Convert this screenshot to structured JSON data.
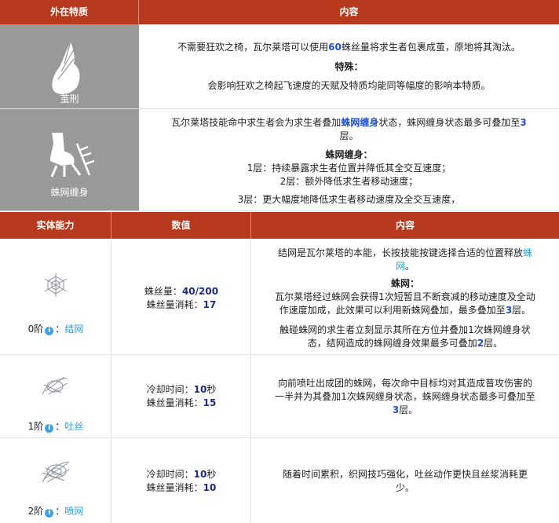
{
  "table1": {
    "headers": [
      "外在特质",
      "内容"
    ],
    "rows": [
      {
        "name": "茧刑",
        "line1_pre": "不需要狂欢之椅，瓦尔莱塔可以使用",
        "line1_num": "60",
        "line1_post": "蛛丝量将求生者包裹成茧，原地将其淘汰。",
        "special_title": "特殊：",
        "special_text": "会影响狂欢之椅起飞速度的天赋及特质均能同等幅度的影响本特质。"
      },
      {
        "name": "蛛网缠身",
        "l1_pre": "瓦尔莱塔技能命中求生者会为求生者叠加",
        "l1_link": "蛛网缠身",
        "l1_mid": "状态，蛛网缠身状态最多可叠加至",
        "l1_num": "3",
        "l2": "层。",
        "sub_title": "蛛网缠身：",
        "layer1": "1层：持续暴露求生者位置并降低其全交互速度；",
        "layer2": "2层：额外降低求生者移动速度；",
        "layer3": "3层：更大幅度地降低求生者移动速度及全交互速度，"
      }
    ]
  },
  "table2": {
    "headers": [
      "实体能力",
      "数值",
      "内容"
    ],
    "rows": [
      {
        "tier": "0阶",
        "info": "i",
        "sep": "：",
        "skill": "结网",
        "v1_label": "蛛丝量：",
        "v1_val": "40/200",
        "v2_label": "蛛丝量消耗：",
        "v2_val": "17",
        "p1_a": "结网是瓦尔莱塔的本能，长按技能按键选择合适的位置释放",
        "p1_link_a": "蛛",
        "p1_link_b": "网",
        "p1_end": "。",
        "sub_title": "蛛网：",
        "p2_a": "瓦尔莱塔经过蛛网会获得1次短暂且不断衰减的移动速度及全动",
        "p2_b": "作速度加成，此效果可以利用新蛛网叠加，最多叠加至",
        "p2_num": "3",
        "p2_end": "层。",
        "p3_a": "触碰蛛网的求生者立刻显示其所在方位并叠加1次蛛网缠身状",
        "p3_b": "态，结网造成的蛛网缠身效果最多可叠加",
        "p3_num": "2",
        "p3_end": "层。"
      },
      {
        "tier": "1阶",
        "info": "i",
        "sep": "：",
        "skill": "吐丝",
        "v1_label": "冷却时间：",
        "v1_val": "10",
        "v1_unit": "秒",
        "v2_label": "蛛丝量消耗：",
        "v2_val": "15",
        "c_a": "向前喷吐出成团的蛛网，每次命中目标均对其造成普攻伤害的",
        "c_b": "一半并为其叠加1次蛛网缠身状态，蛛网缠身状态最多可叠加至",
        "c_num": "3",
        "c_end": "层。"
      },
      {
        "tier": "2阶",
        "info": "i",
        "sep": "：",
        "skill": "喷网",
        "v1_label": "冷却时间：",
        "v1_val": "10",
        "v1_unit": "秒",
        "v2_label": "蛛丝量消耗：",
        "v2_val": "10",
        "c_a": "随着时间累积，织网技巧强化，吐丝动作更快且丝浆消耗更",
        "c_b": "少。"
      }
    ]
  }
}
